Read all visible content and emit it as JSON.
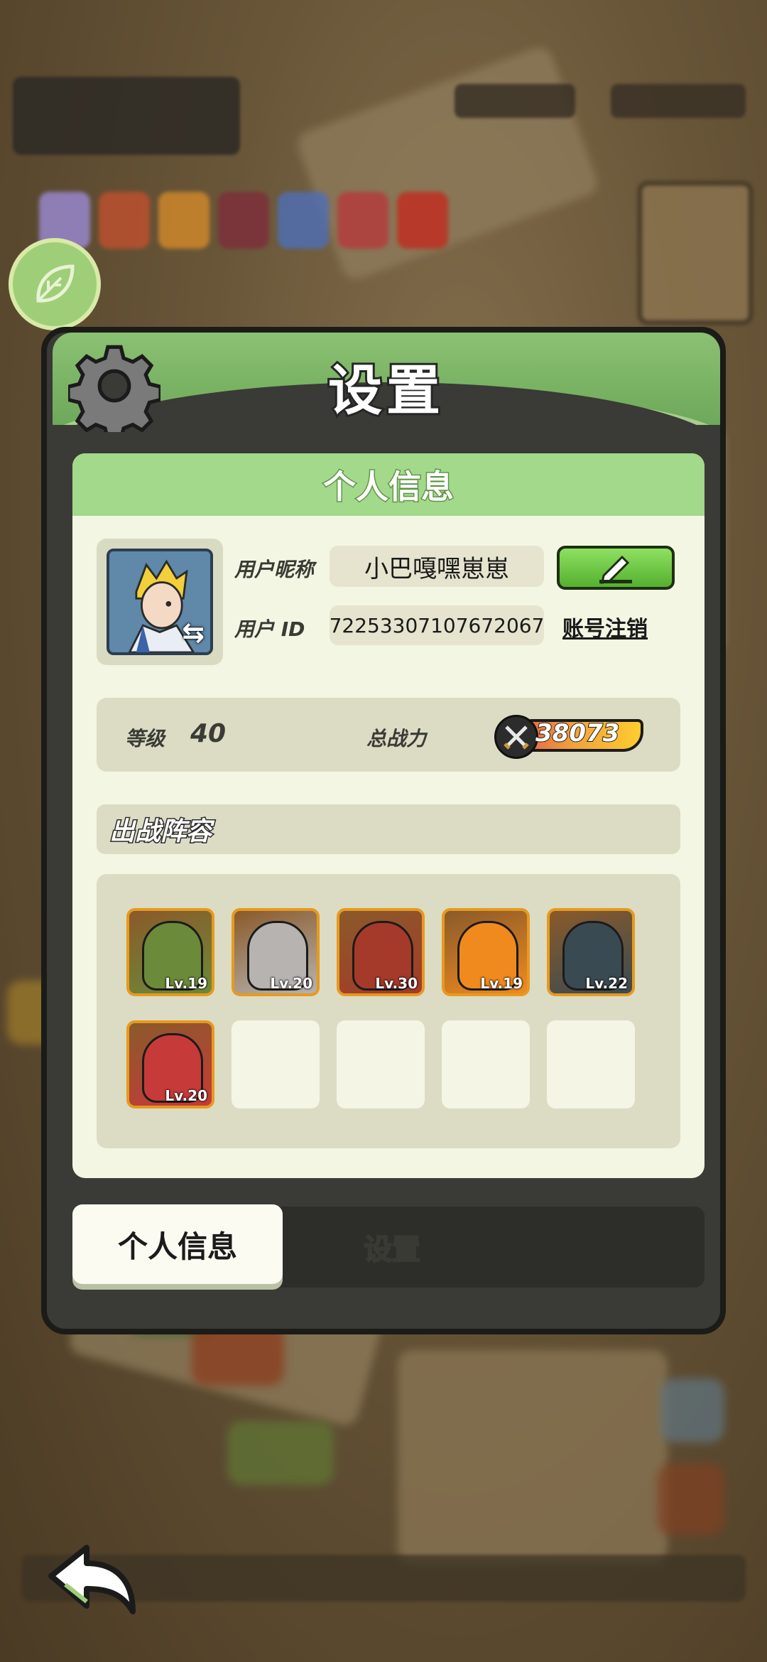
{
  "panel": {
    "title": "设置",
    "section_header": "个人信息"
  },
  "profile": {
    "nickname_label": "用户昵称",
    "nickname_value": "小巴嘎嘿崽崽",
    "id_label": "用户 ID",
    "id_value": "72253307107672067",
    "deregister_label": "账号注销",
    "level_label": "等级",
    "level_value": "40",
    "power_label": "总战力",
    "power_value": "38073"
  },
  "lineup": {
    "title": "出战阵容",
    "heroes": [
      {
        "level": "Lv.19",
        "color": "#6b8a3a"
      },
      {
        "level": "Lv.20",
        "color": "#b7b3b0"
      },
      {
        "level": "Lv.30",
        "color": "#a53a2a"
      },
      {
        "level": "Lv.19",
        "color": "#f08a1f"
      },
      {
        "level": "Lv.22",
        "color": "#3a4a52"
      },
      {
        "level": "Lv.20",
        "color": "#c73a3a"
      }
    ],
    "empty_slots": 4
  },
  "tabs": {
    "active": "个人信息",
    "inactive": "设置"
  },
  "colors": {
    "header_green": "#8bc172",
    "content_bg": "#f3f6e2",
    "hero_border": "#e79a1d"
  }
}
